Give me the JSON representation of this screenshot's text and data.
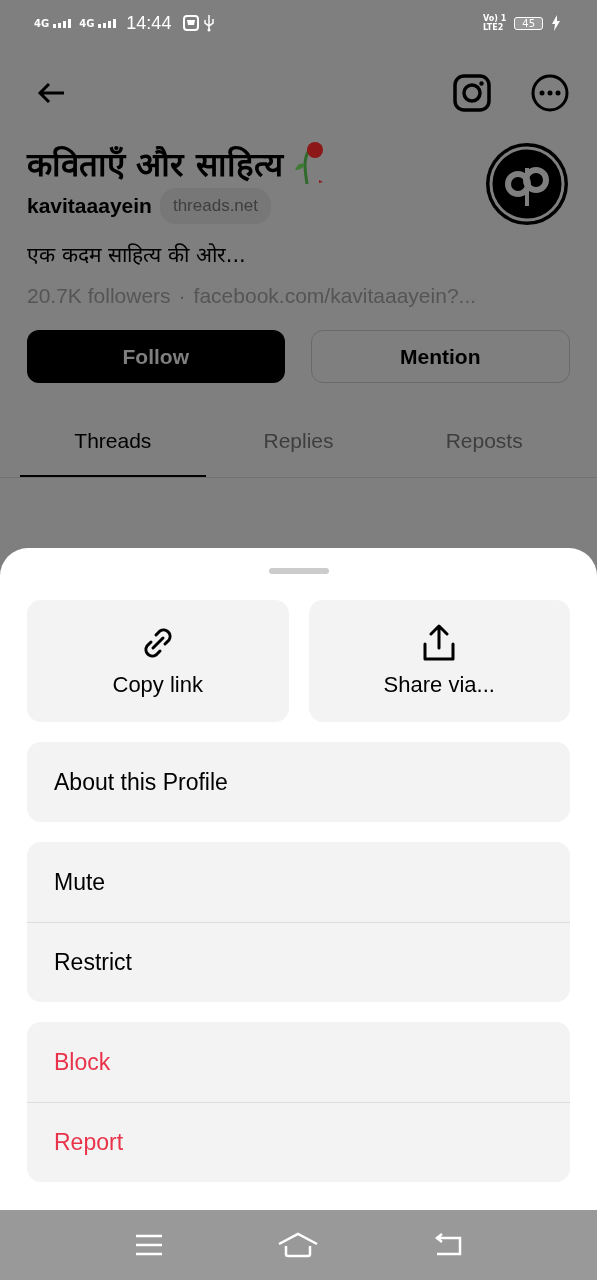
{
  "status_bar": {
    "network_1": "4G",
    "network_2": "4G",
    "time": "14:44",
    "volte": "Vo) 1",
    "lte": "LTE2",
    "battery": "45"
  },
  "profile": {
    "name": "कविताएँ और साहित्य",
    "handle": "kavitaaayein",
    "domain_badge": "threads.net",
    "bio": "एक कदम साहित्य की ओर...",
    "followers": "20.7K followers",
    "separator": "·",
    "link": "facebook.com/kavitaaayein?..."
  },
  "actions": [
    {
      "label": "Follow",
      "kind": "primary"
    },
    {
      "label": "Mention",
      "kind": "outline"
    }
  ],
  "tabs": [
    {
      "label": "Threads",
      "selected": true
    },
    {
      "label": "Replies",
      "selected": false
    },
    {
      "label": "Reposts",
      "selected": false
    }
  ],
  "sheet": {
    "share_tiles": [
      {
        "label": "Copy link",
        "kind": "link"
      },
      {
        "label": "Share via...",
        "kind": "share"
      }
    ],
    "groups": [
      [
        {
          "label": "About this Profile",
          "destructive": false
        }
      ],
      [
        {
          "label": "Mute",
          "destructive": false
        },
        {
          "label": "Restrict",
          "destructive": false
        }
      ],
      [
        {
          "label": "Block",
          "destructive": true
        },
        {
          "label": "Report",
          "destructive": true
        }
      ]
    ]
  }
}
